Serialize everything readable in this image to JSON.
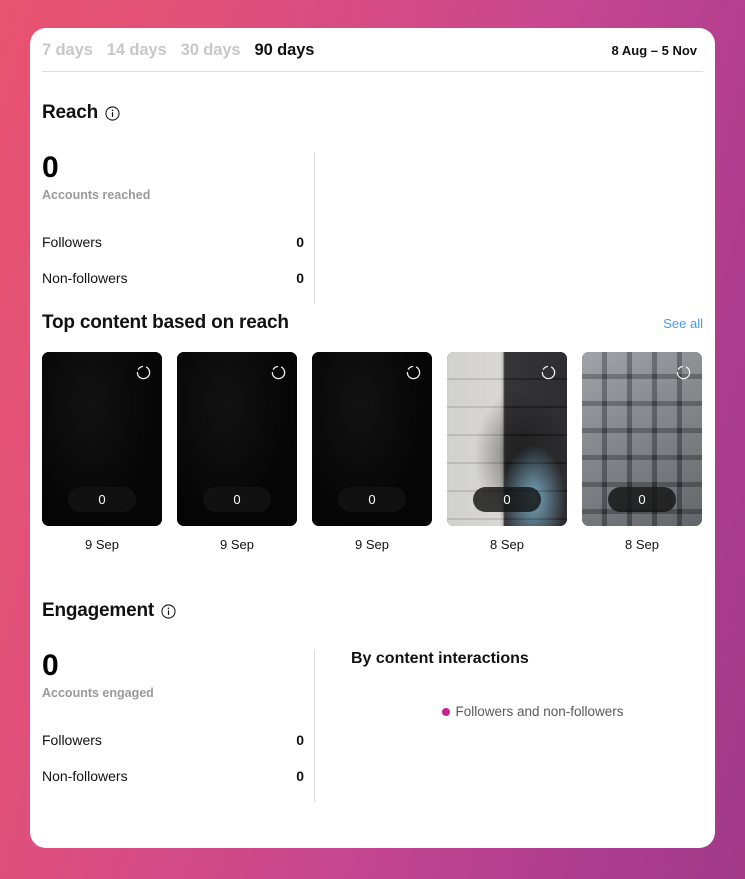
{
  "header": {
    "tabs": [
      {
        "label": "7 days",
        "active": false
      },
      {
        "label": "14 days",
        "active": false
      },
      {
        "label": "30 days",
        "active": false
      },
      {
        "label": "90 days",
        "active": true
      }
    ],
    "date_range": "8 Aug – 5 Nov"
  },
  "reach": {
    "title": "Reach",
    "info_icon": "info-icon",
    "big_number": "0",
    "big_label": "Accounts reached",
    "rows": [
      {
        "key": "Followers",
        "value": "0"
      },
      {
        "key": "Non-followers",
        "value": "0"
      }
    ]
  },
  "top_content": {
    "title": "Top content based on reach",
    "see_all": "See all",
    "items": [
      {
        "count": "0",
        "date": "9 Sep",
        "spinner_icon": "loading-spinner-icon",
        "style": "bg-dark"
      },
      {
        "count": "0",
        "date": "9 Sep",
        "spinner_icon": "loading-spinner-icon",
        "style": "bg-dark"
      },
      {
        "count": "0",
        "date": "9 Sep",
        "spinner_icon": "loading-spinner-icon",
        "style": "bg-dark"
      },
      {
        "count": "0",
        "date": "8 Sep",
        "spinner_icon": "loading-spinner-icon",
        "style": "bg-photo-a"
      },
      {
        "count": "0",
        "date": "8 Sep",
        "spinner_icon": "loading-spinner-icon",
        "style": "bg-photo-b"
      }
    ]
  },
  "engagement": {
    "title": "Engagement",
    "info_icon": "info-icon",
    "big_number": "0",
    "big_label": "Accounts engaged",
    "rows": [
      {
        "key": "Followers",
        "value": "0"
      },
      {
        "key": "Non-followers",
        "value": "0"
      }
    ],
    "chart": {
      "title": "By content interactions",
      "legend": [
        {
          "label": "Followers and non-followers",
          "color": "#c7208f"
        }
      ]
    }
  },
  "colors": {
    "accent_link": "#4a9ae8",
    "legend_magenta": "#c7208f",
    "muted_text": "#9a9a9a",
    "divider": "#dcdcdc",
    "bg_gradient_start": "#e8536e",
    "bg_gradient_end": "#a23a88"
  },
  "chart_data": {
    "type": "pie",
    "title": "By content interactions",
    "categories": [
      "Followers and non-followers"
    ],
    "values": [
      0
    ],
    "legend": [
      "Followers and non-followers"
    ],
    "legend_position": "center",
    "grid": false,
    "note": "No data rendered — all interaction counts are 0"
  }
}
